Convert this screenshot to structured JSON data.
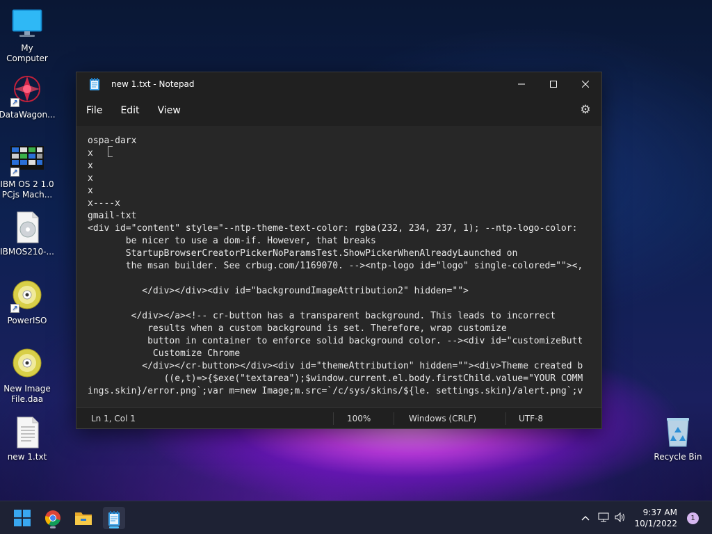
{
  "desktop": {
    "icons": [
      {
        "label": "My Computer",
        "icon": "monitor-icon"
      },
      {
        "label": "DataWagon...",
        "icon": "datawagon-icon"
      },
      {
        "label": "IBM OS 2 1.0\nPCjs Mach...",
        "icon": "ibm-os2-icon"
      },
      {
        "label": "IBMOS210-...",
        "icon": "disk-image-icon"
      },
      {
        "label": "PowerISO",
        "icon": "poweriso-icon"
      },
      {
        "label": "New Image\nFile.daa",
        "icon": "daa-file-icon"
      },
      {
        "label": "new 1.txt",
        "icon": "text-file-icon"
      },
      {
        "label": "Recycle Bin",
        "icon": "recycle-bin-icon"
      }
    ]
  },
  "notepad": {
    "title": "new 1.txt - Notepad",
    "menu": {
      "file": "File",
      "edit": "Edit",
      "view": "View"
    },
    "lines": [
      "ospa-darx",
      "x",
      "x",
      "x",
      "x",
      "x----x",
      "gmail-txt",
      "<div id=\"content\" style=\"--ntp-theme-text-color: rgba(232, 234, 237, 1); --ntp-logo-color:",
      "       be nicer to use a dom-if. However, that breaks",
      "       StartupBrowserCreatorPickerNoParamsTest.ShowPickerWhenAlreadyLaunched on",
      "       the msan builder. See crbug.com/1169070. --><ntp-logo id=\"logo\" single-colored=\"\"><,",
      "",
      "          </div></div><div id=\"backgroundImageAttribution2\" hidden=\"\">",
      "",
      "        </div></a><!-- cr-button has a transparent background. This leads to incorrect",
      "           results when a custom background is set. Therefore, wrap customize",
      "           button in container to enforce solid background color. --><div id=\"customizeButt",
      "            Customize Chrome",
      "          </div></cr-button></div><div id=\"themeAttribution\" hidden=\"\"><div>Theme created b",
      "              ((e,t)=>{$exe(\"textarea\");$window.current.el.body.firstChild.value=\"YOUR COMM",
      "ings.skin}/error.png`;var m=new Image;m.src=`/c/sys/skins/${le. settings.skin}/alert.png`;v"
    ],
    "status": {
      "position": "Ln 1, Col 1",
      "zoom": "100%",
      "line_ending": "Windows (CRLF)",
      "encoding": "UTF-8"
    }
  },
  "taskbar": {
    "apps": [
      "start-icon",
      "chrome-icon",
      "file-explorer-icon",
      "notepad-icon"
    ],
    "clock": {
      "time": "9:37 AM",
      "date": "10/1/2022"
    },
    "notification_count": "1"
  }
}
